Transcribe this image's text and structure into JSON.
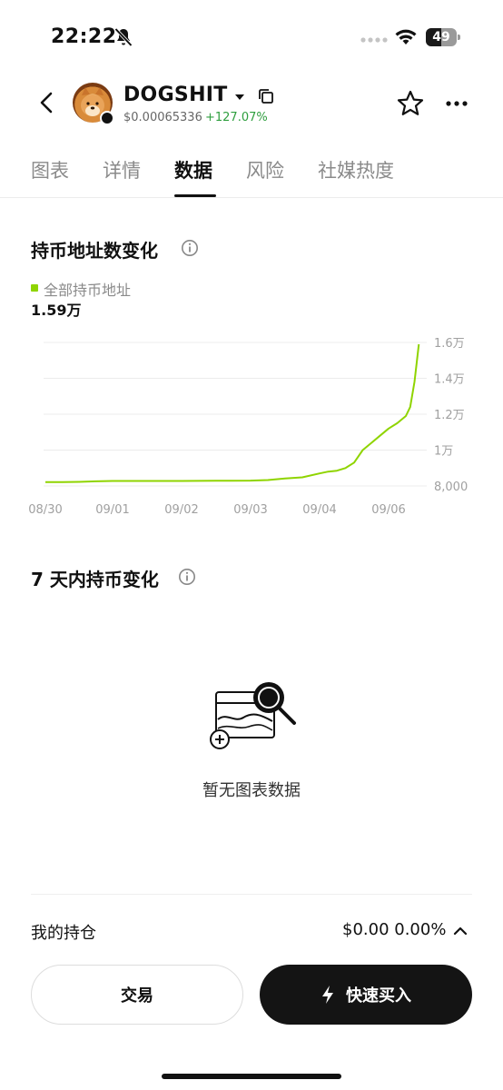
{
  "status_bar": {
    "time": "22:22",
    "battery": "49",
    "battery_level": 0.49
  },
  "header": {
    "token_name": "DOGSHIT",
    "price": "$0.00065336",
    "change": "+127.07%",
    "change_color": "#2e9e3e"
  },
  "tabs": [
    {
      "label": "图表",
      "active": false
    },
    {
      "label": "详情",
      "active": false
    },
    {
      "label": "数据",
      "active": true
    },
    {
      "label": "风险",
      "active": false
    },
    {
      "label": "社媒热度",
      "active": false
    }
  ],
  "holders_section": {
    "title": "持币地址数变化",
    "legend_label": "全部持币地址",
    "current_value": "1.59万"
  },
  "chart_data": {
    "type": "line",
    "title": "持币地址数变化",
    "xlabel": "",
    "ylabel": "",
    "x_ticks": [
      "08/30",
      "09/01",
      "09/02",
      "09/03",
      "09/04",
      "09/06"
    ],
    "y_ticks": [
      "1.6万",
      "1.4万",
      "1.2万",
      "1万",
      "8,000"
    ],
    "ylim": [
      8000,
      16000
    ],
    "grid": true,
    "series": [
      {
        "name": "全部持币地址",
        "color": "#8fd400",
        "x": [
          "08/30 00:00",
          "08/30 12:00",
          "08/31 00:00",
          "08/31 12:00",
          "09/01 00:00",
          "09/01 12:00",
          "09/02 00:00",
          "09/02 12:00",
          "09/03 00:00",
          "09/03 06:00",
          "09/03 12:00",
          "09/03 18:00",
          "09/04 00:00",
          "09/04 06:00",
          "09/04 12:00",
          "09/04 18:00",
          "09/05 00:00",
          "09/05 06:00",
          "09/05 12:00",
          "09/05 18:00",
          "09/06 00:00",
          "09/06 06:00",
          "09/06 12:00",
          "09/06 15:00",
          "09/06 18:00",
          "09/06 21:00"
        ],
        "values": [
          8220,
          8220,
          8230,
          8260,
          8280,
          8280,
          8280,
          8290,
          8300,
          8330,
          8420,
          8480,
          8700,
          8800,
          8850,
          9000,
          9300,
          10000,
          10400,
          10800,
          11200,
          11500,
          11900,
          12400,
          13800,
          15900
        ]
      }
    ]
  },
  "seven_day_section": {
    "title": "7 天内持币变化",
    "empty_text": "暂无图表数据"
  },
  "holdings": {
    "label": "我的持仓",
    "value": "$0.00 0.00%"
  },
  "actions": {
    "trade_label": "交易",
    "buy_label": "快速买入"
  },
  "icons": {
    "back": "back-arrow-icon",
    "mute": "bell-slash-icon",
    "wifi": "wifi-icon",
    "copy": "copy-icon",
    "star": "star-icon",
    "more": "more-icon",
    "info": "info-icon",
    "bolt": "lightning-icon",
    "chevron": "chevron-up-icon"
  }
}
